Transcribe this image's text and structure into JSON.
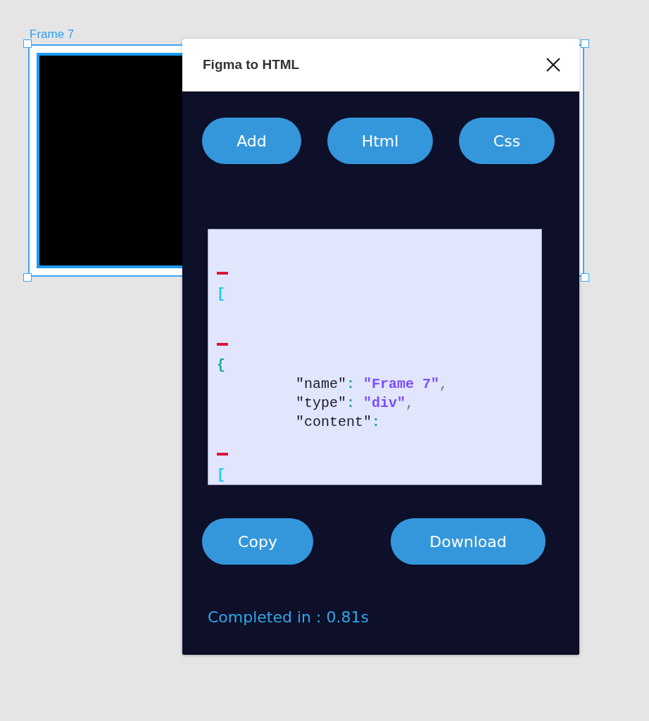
{
  "canvas": {
    "frame_label": "Frame 7"
  },
  "plugin": {
    "title": "Figma to HTML",
    "mode_buttons": [
      "Add",
      "Html",
      "Css"
    ],
    "code_lines": [
      {
        "kind": "marker"
      },
      {
        "kind": "bracket",
        "text": "["
      },
      {
        "kind": "marker"
      },
      {
        "kind": "brace",
        "text": "{"
      },
      {
        "kind": "entry",
        "key": "\"name\"",
        "colon": ":",
        "value": "\"Frame 7\"",
        "comma": ","
      },
      {
        "kind": "entry",
        "key": "\"type\"",
        "colon": ":",
        "value": "\"div\"",
        "comma": ","
      },
      {
        "kind": "entry",
        "key": "\"content\"",
        "colon": ":"
      },
      {
        "kind": "marker"
      },
      {
        "kind": "bracket",
        "text": "["
      }
    ],
    "action_buttons": [
      "Copy",
      "Download"
    ],
    "status": "Completed in : 0.81s"
  }
}
